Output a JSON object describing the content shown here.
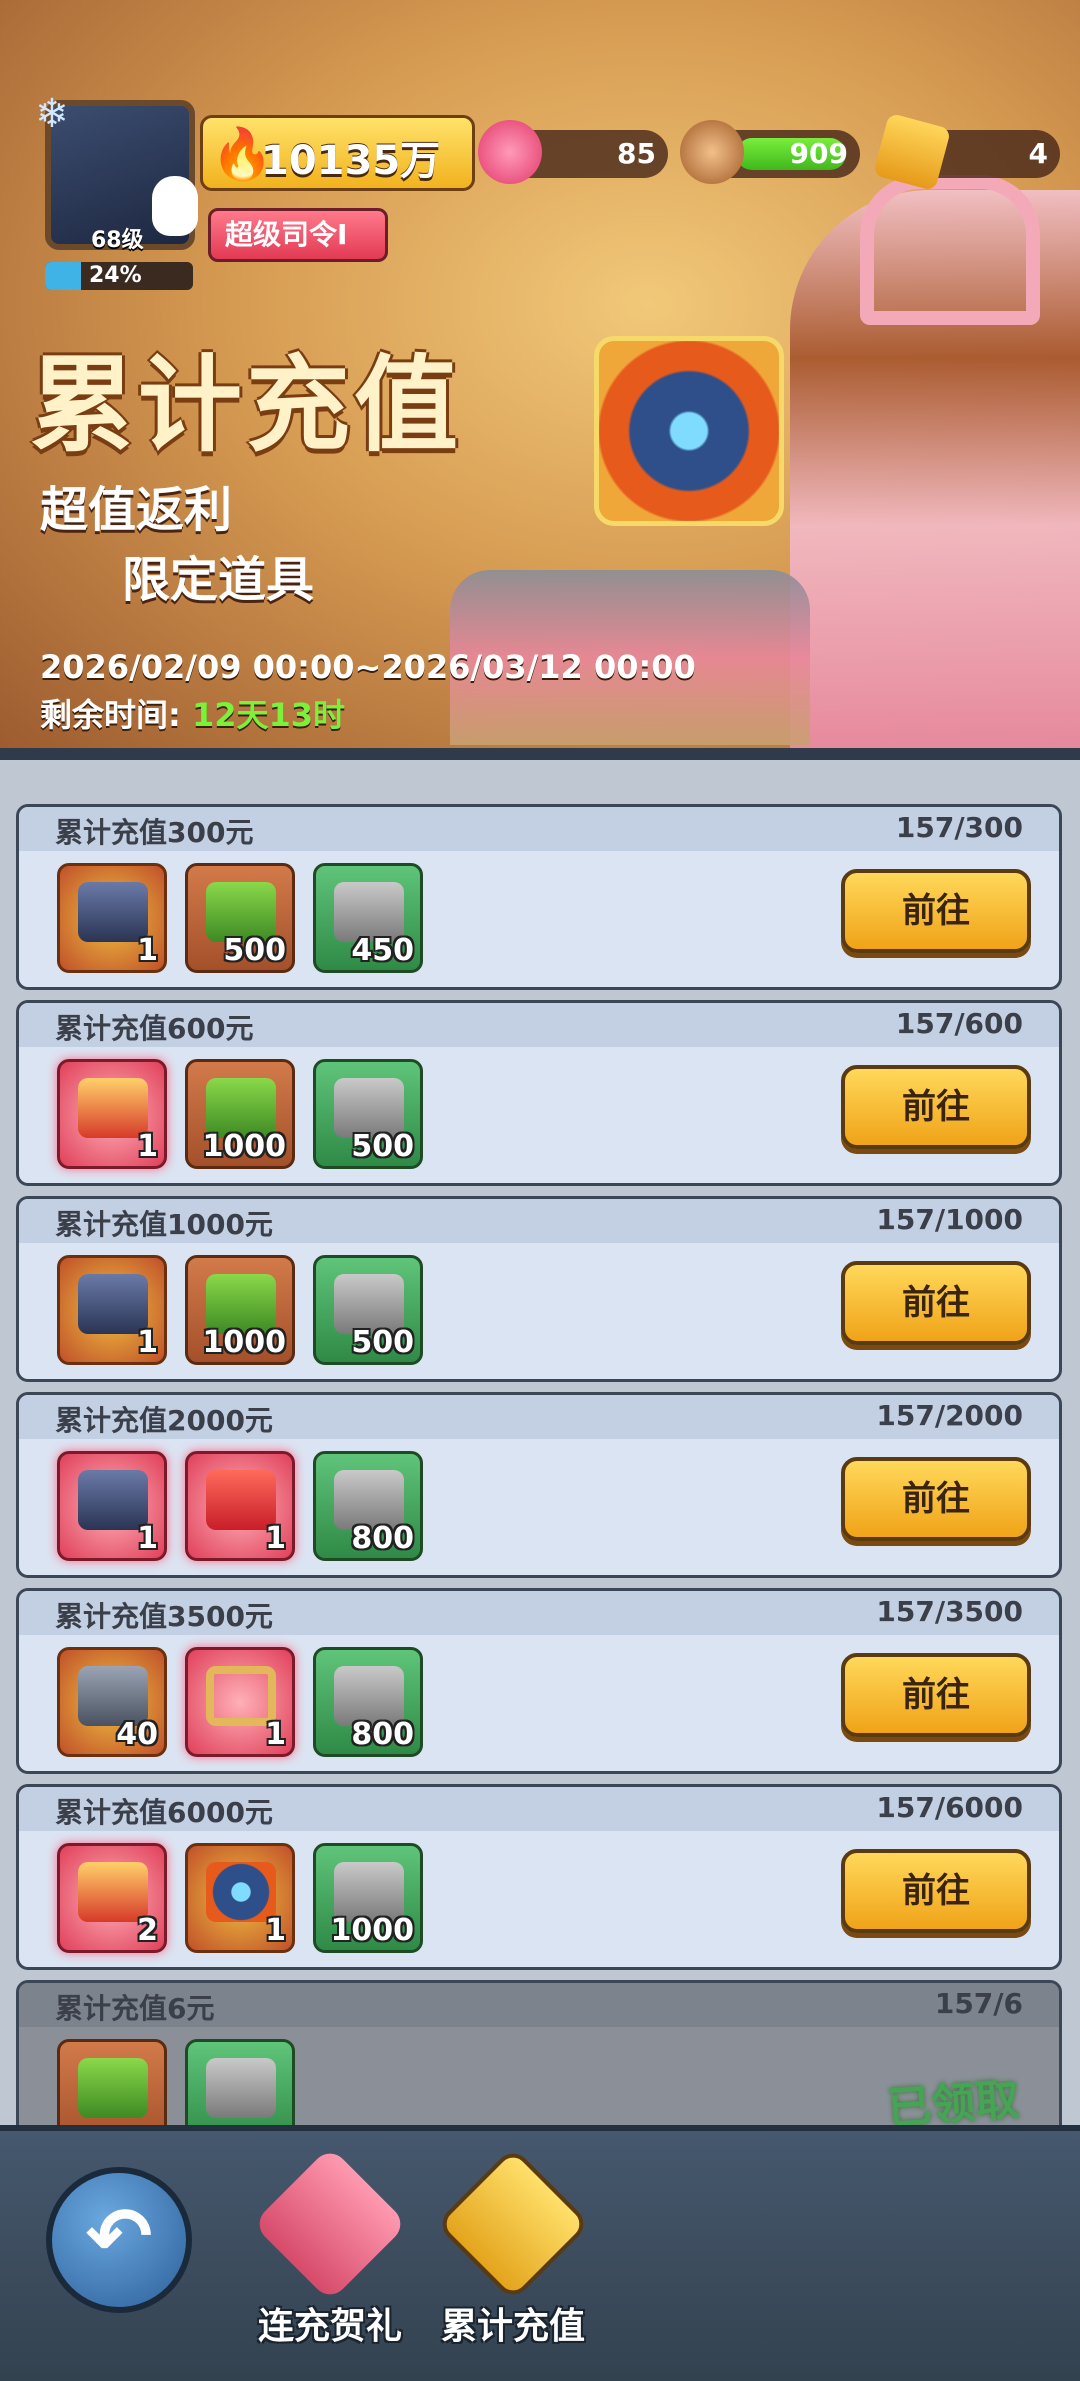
{
  "player": {
    "level": "68级",
    "exp_percent": "24%",
    "power": "10135万",
    "title": "超级司令I"
  },
  "resources": [
    {
      "icon": "gem-icon",
      "value": "85"
    },
    {
      "icon": "wood-icon",
      "value": "909"
    },
    {
      "icon": "ticket-icon",
      "value": "4"
    }
  ],
  "banner": {
    "title": "累计充值",
    "subtitle1": "超值返利",
    "subtitle2": "限定道具",
    "date_range": "2026/02/09 00:00~2026/03/12 00:00",
    "remaining_label": "剩余时间:",
    "remaining_value": "12天13时"
  },
  "tiers": [
    {
      "title": "累计充值300元",
      "progress": "157/300",
      "items": [
        {
          "type": "mech",
          "style": "gold",
          "qty": "1"
        },
        {
          "type": "cash",
          "style": "orange",
          "qty": "500"
        },
        {
          "type": "can",
          "style": "green",
          "qty": "450"
        }
      ],
      "action": "前往"
    },
    {
      "title": "累计充值600元",
      "progress": "157/600",
      "items": [
        {
          "type": "claw",
          "style": "red",
          "qty": "1"
        },
        {
          "type": "cash",
          "style": "orange",
          "qty": "1000"
        },
        {
          "type": "can",
          "style": "green",
          "qty": "500"
        }
      ],
      "action": "前往"
    },
    {
      "title": "累计充值1000元",
      "progress": "157/1000",
      "items": [
        {
          "type": "mech",
          "style": "gold",
          "qty": "1"
        },
        {
          "type": "cash",
          "style": "orange",
          "qty": "1000"
        },
        {
          "type": "can",
          "style": "green",
          "qty": "500"
        }
      ],
      "action": "前往"
    },
    {
      "title": "累计充值2000元",
      "progress": "157/2000",
      "items": [
        {
          "type": "mech",
          "style": "red",
          "qty": "1"
        },
        {
          "type": "ticket",
          "style": "red",
          "qty": "1"
        },
        {
          "type": "can",
          "style": "green",
          "qty": "800"
        }
      ],
      "action": "前往"
    },
    {
      "title": "累计充值3500元",
      "progress": "157/3500",
      "items": [
        {
          "type": "helm",
          "style": "gold",
          "qty": "40"
        },
        {
          "type": "frame",
          "style": "red",
          "qty": "1"
        },
        {
          "type": "can",
          "style": "green",
          "qty": "800"
        }
      ],
      "action": "前往"
    },
    {
      "title": "累计充值6000元",
      "progress": "157/6000",
      "items": [
        {
          "type": "claw",
          "style": "red",
          "qty": "2"
        },
        {
          "type": "orb",
          "style": "gold",
          "qty": "1"
        },
        {
          "type": "can",
          "style": "green",
          "qty": "1000"
        }
      ],
      "action": "前往"
    },
    {
      "title": "累计充值6元",
      "progress": "157/6",
      "items": [
        {
          "type": "cash",
          "style": "orange",
          "qty": ""
        },
        {
          "type": "can",
          "style": "green",
          "qty": ""
        }
      ],
      "action": "已领取",
      "claimed": true
    }
  ],
  "tabs": [
    {
      "label": "连充贺礼"
    },
    {
      "label": "累计充值"
    }
  ]
}
